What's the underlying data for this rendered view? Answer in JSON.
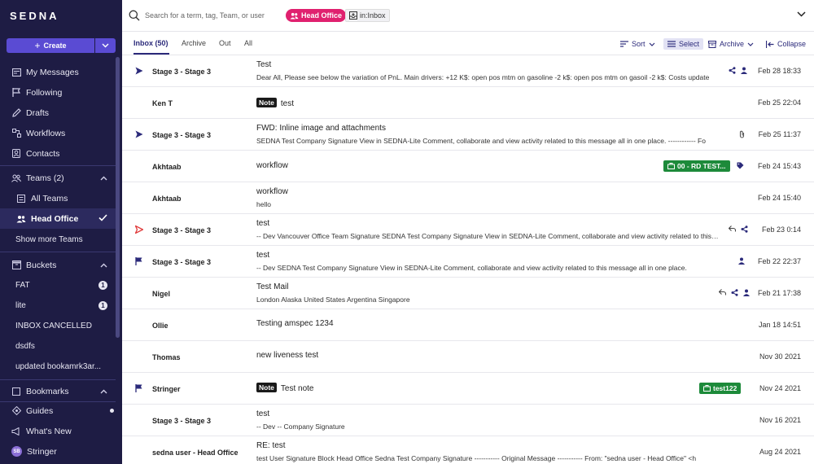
{
  "app": {
    "logo": "SEDNA"
  },
  "sidebar": {
    "create_label": "Create",
    "nav": [
      {
        "label": "My Messages",
        "icon": "messages-icon"
      },
      {
        "label": "Following",
        "icon": "flag-icon"
      },
      {
        "label": "Drafts",
        "icon": "pencil-icon"
      },
      {
        "label": "Workflows",
        "icon": "workflow-icon"
      },
      {
        "label": "Contacts",
        "icon": "contacts-icon"
      }
    ],
    "teams": {
      "label": "Teams (2)",
      "items": [
        {
          "label": "All Teams"
        },
        {
          "label": "Head Office",
          "active": true
        }
      ],
      "show_more": "Show more Teams"
    },
    "buckets": {
      "label": "Buckets",
      "items": [
        {
          "label": "FAT",
          "count": "1"
        },
        {
          "label": "lite",
          "count": "1"
        },
        {
          "label": "INBOX CANCELLED"
        },
        {
          "label": "dsdfs"
        },
        {
          "label": "updated bookamrk3ar..."
        }
      ]
    },
    "bookmarks": {
      "label": "Bookmarks"
    },
    "footer": [
      {
        "label": "Guides",
        "icon": "guides-icon"
      },
      {
        "label": "What's New",
        "icon": "megaphone-icon"
      },
      {
        "label": "Stringer",
        "initials": "SB"
      }
    ]
  },
  "search": {
    "placeholder": "Search for a term, tag, Team, or user",
    "chips": {
      "team": "Head Office",
      "folder": "in:Inbox"
    }
  },
  "tabs": [
    {
      "label": "Inbox (50)",
      "active": true
    },
    {
      "label": "Archive"
    },
    {
      "label": "Out"
    },
    {
      "label": "All"
    }
  ],
  "toolbar": {
    "sort": "Sort",
    "select": "Select",
    "archive": "Archive",
    "collapse": "Collapse"
  },
  "messages": [
    {
      "sender": "Stage 3 - Stage 3",
      "subject": "Test",
      "snippet": "Dear All, Please see below the variation of PnL. Main drivers: +12 K$: open pos mtm on gasoline -2 k$: open pos mtm on gasoil -2 k$: Costs update",
      "date": "Feb 28 18:33",
      "flag": "send",
      "icons": [
        "share",
        "person"
      ]
    },
    {
      "sender": "Ken T",
      "note": "Note",
      "subject": "test",
      "date": "Feb 25 22:04"
    },
    {
      "sender": "Stage 3 - Stage 3",
      "subject": "FWD: Inline image and attachments",
      "snippet": "SEDNA Test Company Signature View in SEDNA-Lite Comment, collaborate and view activity related to this message all in one place. ------------ Fo",
      "date": "Feb 25 11:37",
      "flag": "send",
      "icons": [
        "attach"
      ]
    },
    {
      "sender": "Akhtaab",
      "subject": "workflow",
      "tag": "00 - RD TEST...",
      "date": "Feb 24 15:43",
      "icons": [
        "tag"
      ]
    },
    {
      "sender": "Akhtaab",
      "subject": "workflow",
      "snippet": "hello",
      "date": "Feb 24 15:40"
    },
    {
      "sender": "Stage 3 - Stage 3",
      "subject": "test",
      "snippet": "-- Dev Vancouver Office Team Signature SEDNA Test Company Signature View in SEDNA-Lite Comment, collaborate and view activity related to this message",
      "date": "Feb 23 0:14",
      "flag": "send-red",
      "icons": [
        "reply",
        "share"
      ]
    },
    {
      "sender": "Stage 3 - Stage 3",
      "subject": "test",
      "snippet": "-- Dev SEDNA Test Company Signature View in SEDNA-Lite Comment, collaborate and view activity related to this message all in one place.",
      "date": "Feb 22 22:37",
      "flag": "flag",
      "icons": [
        "person"
      ]
    },
    {
      "sender": "Nigel",
      "subject": "Test Mail",
      "snippet": "London Alaska United States Argentina Singapore",
      "date": "Feb 21 17:38",
      "icons": [
        "reply",
        "share",
        "person"
      ]
    },
    {
      "sender": "Ollie",
      "subject": "Testing amspec 1234",
      "date": "Jan 18 14:51"
    },
    {
      "sender": "Thomas",
      "subject": "new liveness test",
      "date": "Nov 30 2021"
    },
    {
      "sender": "Stringer",
      "note": "Note",
      "subject": "Test note",
      "tag": "test122",
      "date": "Nov 24 2021",
      "flag": "flag"
    },
    {
      "sender": "Stage 3 - Stage 3",
      "subject": "test",
      "snippet": "-- Dev -- Company Signature",
      "date": "Nov 16 2021"
    },
    {
      "sender": "sedna user - Head Office",
      "subject": "RE: test",
      "snippet": "test User Signature Block Head Office Sedna Test Company Signature ----------- Original Message ----------- From: \"sedna user - Head Office\" <h",
      "date": "Aug 24 2021"
    }
  ]
}
